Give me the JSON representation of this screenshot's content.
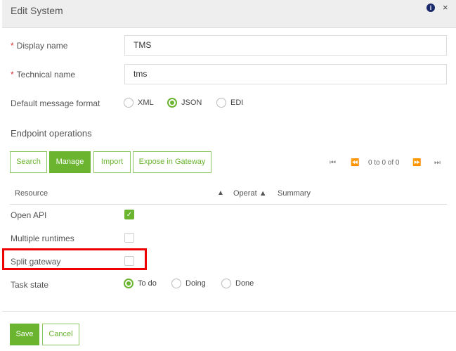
{
  "dialog": {
    "title": "Edit System",
    "info_icon": "info-circle-icon",
    "close_label": "×"
  },
  "fields": {
    "display_name": {
      "label": "Display name",
      "value": "TMS",
      "required": true
    },
    "technical_name": {
      "label": "Technical name",
      "value": "tms",
      "required": true
    },
    "format": {
      "label": "Default message format",
      "options": [
        "XML",
        "JSON",
        "EDI"
      ],
      "selected": "JSON"
    }
  },
  "endpoint": {
    "title": "Endpoint operations",
    "buttons": [
      "Search",
      "Manage",
      "Import",
      "Expose in Gateway"
    ],
    "active": "Manage",
    "paging": {
      "text": "0 to 0 of 0"
    },
    "columns": [
      "Resource",
      "Operat",
      "Summary"
    ]
  },
  "flags": [
    {
      "label": "Open API",
      "checked": true
    },
    {
      "label": "Multiple runtimes",
      "checked": false
    },
    {
      "label": "Split gateway",
      "checked": false
    }
  ],
  "task_state": {
    "label": "Task state",
    "options": [
      "To do",
      "Doing",
      "Done"
    ],
    "selected": "To do"
  },
  "footer": {
    "save": "Save",
    "cancel": "Cancel"
  },
  "accent": "#6ab42f"
}
